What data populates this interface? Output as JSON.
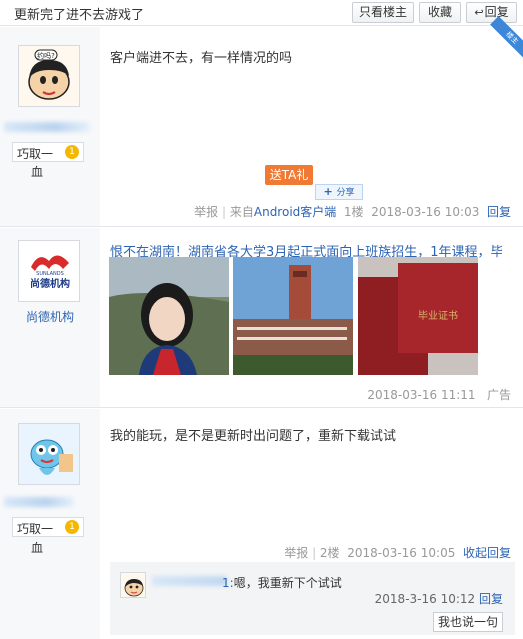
{
  "header": {
    "title": "更新完了进不去游戏了",
    "only_lz": "只看楼主",
    "collect": "收藏",
    "reply": "回复"
  },
  "post1": {
    "lz_tag": "楼主",
    "badge": "巧取一",
    "badge_level": "1",
    "blood": "血",
    "content": "客户端进不去，有一样情况的吗",
    "gift": "送TA礼",
    "share": "分享",
    "report": "举报",
    "from": "来自",
    "client": "Android客户端",
    "floor": "1楼",
    "time": "2018-03-16 10:03",
    "reply": "回复"
  },
  "ad": {
    "logo_text": "尚德机构",
    "logo_sub": "SUNLANDS",
    "name": "尚德机构",
    "title": "恨不在湖南！湖南省各大学3月起正式面向上班族招生，1年课程，毕业...",
    "cert_text": "毕业证书",
    "time": "2018-03-16  11:11",
    "label": "广告"
  },
  "post2": {
    "badge": "巧取一",
    "badge_level": "1",
    "blood": "血",
    "content": "我的能玩，是不是更新时出问题了，重新下载试试",
    "report": "举报",
    "floor": "2楼",
    "time": "2018-03-16 10:05",
    "collapse": "收起回复"
  },
  "subreply": {
    "text": "嗯，我重新下个试试",
    "time": "2018-3-16 10:12",
    "reply": "回复",
    "say_button": "我也说一句"
  },
  "colors": {
    "link": "#2d64b3",
    "gift": "#f07a33",
    "meta": "#999999"
  }
}
